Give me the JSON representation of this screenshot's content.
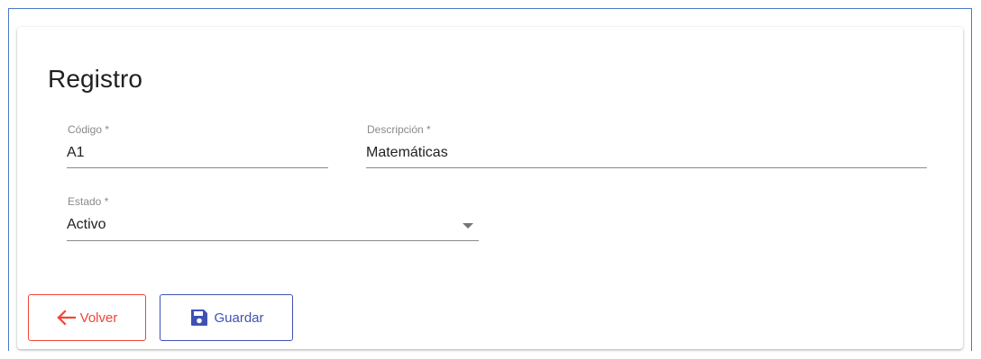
{
  "form": {
    "title": "Registro",
    "fields": {
      "codigo": {
        "label": "Código *",
        "value": "A1"
      },
      "descripcion": {
        "label": "Descripción *",
        "value": "Matemáticas"
      },
      "estado": {
        "label": "Estado *",
        "value": "Activo"
      }
    }
  },
  "actions": {
    "volver_label": "Volver",
    "guardar_label": "Guardar"
  },
  "colors": {
    "frame_border": "#4a78c8",
    "volver": "#f44336",
    "guardar": "#3f51b5"
  },
  "icons": {
    "volver": "arrow-left-icon",
    "guardar": "save-icon",
    "estado_select": "caret-down-icon"
  }
}
